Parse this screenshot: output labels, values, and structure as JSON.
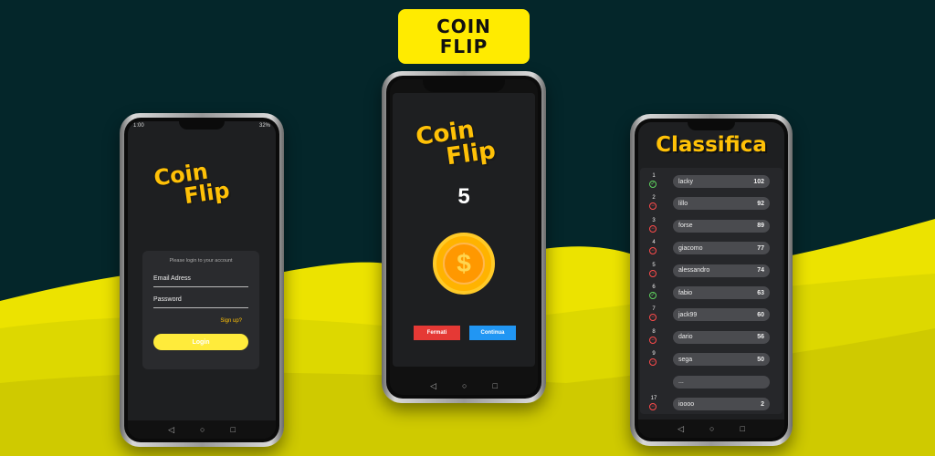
{
  "badge": {
    "line1": "COIN",
    "line2": "FLIP"
  },
  "colors": {
    "accent": "#ffc107",
    "badge": "#ffeb00",
    "red": "#e53935",
    "blue": "#2196f3",
    "dark": "#04262a"
  },
  "login_phone": {
    "status_time": "1:00",
    "status_right": "32%",
    "logo_line1": "Coin",
    "logo_line2": "Flip",
    "prompt": "Please login to your account",
    "email_label": "Email Adress",
    "password_label": "Password",
    "signup_link": "Sign up?",
    "login_button": "Login"
  },
  "game_phone": {
    "logo_line1": "Coin",
    "logo_line2": "Flip",
    "count": "5",
    "coin_symbol": "$",
    "stop_button": "Fermati",
    "continue_button": "Continua"
  },
  "ranking_phone": {
    "title": "Classifica",
    "rows": [
      {
        "rank": "1",
        "status": "ok",
        "name": "lacky",
        "score": "102"
      },
      {
        "rank": "2",
        "status": "no",
        "name": "lillo",
        "score": "92"
      },
      {
        "rank": "3",
        "status": "no",
        "name": "forse",
        "score": "89"
      },
      {
        "rank": "4",
        "status": "no",
        "name": "giacomo",
        "score": "77"
      },
      {
        "rank": "5",
        "status": "no",
        "name": "alessandro",
        "score": "74"
      },
      {
        "rank": "6",
        "status": "ok",
        "name": "fabio",
        "score": "63"
      },
      {
        "rank": "7",
        "status": "no",
        "name": "jack99",
        "score": "60"
      },
      {
        "rank": "8",
        "status": "no",
        "name": "dario",
        "score": "56"
      },
      {
        "rank": "9",
        "status": "no",
        "name": "sega",
        "score": "50"
      },
      {
        "rank": "",
        "status": "",
        "name": "...",
        "score": ""
      },
      {
        "rank": "17",
        "status": "no",
        "name": "ioooo",
        "score": "2"
      }
    ]
  }
}
